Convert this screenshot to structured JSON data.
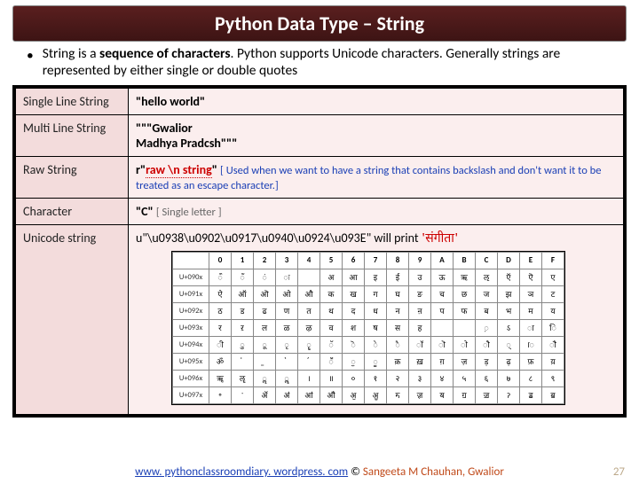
{
  "title": "Python Data Type – String",
  "bullet": {
    "lead": "String is a ",
    "bold": "sequence of characters",
    "rest": ". Python supports Unicode characters. Generally strings are represented by either single or double quotes"
  },
  "rows": {
    "r0": {
      "label": "Single Line String",
      "val": "\"hello world\""
    },
    "r1": {
      "label": "Multi Line String",
      "l1": "\"\"\"Gwalior",
      "l2": "Madhya Pradcsh\"\"\""
    },
    "r2": {
      "label": "Raw String",
      "pre": "r\"",
      "mid": "raw \\n string",
      "post": "\"",
      "note": "[ Used when we want to have a string that contains backslash and don't want it to be treated as an escape character.]"
    },
    "r3": {
      "label": "Character",
      "val": "\"C\"",
      "note": "[ Single letter ]"
    },
    "r4": {
      "label": "Unicode string",
      "code": "u\"\\u0938\\u0902\\u0917\\u0940\\u0924\\u093E\"",
      "tail": " will print ",
      "hindi": "'संगीता'"
    }
  },
  "chart_data": {
    "type": "table",
    "title": "Devanagari Unicode block U+0900–U+097F (partial)",
    "columns": [
      "0",
      "1",
      "2",
      "3",
      "4",
      "5",
      "6",
      "7",
      "8",
      "9",
      "A",
      "B",
      "C",
      "D",
      "E",
      "F"
    ],
    "row_headers": [
      "U+090x",
      "U+091x",
      "U+092x",
      "U+093x",
      "U+094x",
      "U+095x",
      "U+096x",
      "U+097x"
    ],
    "grid": [
      [
        "ऀ",
        "ँ",
        "ं",
        "ः",
        "",
        "अ",
        "आ",
        "इ",
        "ई",
        "उ",
        "ऊ",
        "ऋ",
        "ऌ",
        "ऍ",
        "ऎ",
        "ए"
      ],
      [
        "ऐ",
        "ऑ",
        "ऒ",
        "ओ",
        "औ",
        "क",
        "ख",
        "ग",
        "घ",
        "ङ",
        "च",
        "छ",
        "ज",
        "झ",
        "ञ",
        "ट"
      ],
      [
        "ठ",
        "ड",
        "ढ",
        "ण",
        "त",
        "थ",
        "द",
        "ध",
        "न",
        "ऩ",
        "प",
        "फ",
        "ब",
        "भ",
        "म",
        "य"
      ],
      [
        "र",
        "ऱ",
        "ल",
        "ळ",
        "ऴ",
        "व",
        "श",
        "ष",
        "स",
        "ह",
        "",
        "",
        "़",
        "ऽ",
        "ा",
        "ि"
      ],
      [
        "ी",
        "ु",
        "ू",
        "ृ",
        "ॄ",
        "ॅ",
        "ॆ",
        "े",
        "ै",
        "ॉ",
        "ॊ",
        "ो",
        "ौ",
        "्",
        "ॎ",
        "ॏ"
      ],
      [
        "ॐ",
        "॑",
        "॒",
        "॓",
        "॔",
        "ॕ",
        "ॖ",
        "ॗ",
        "क़",
        "ख़",
        "ग़",
        "ज़",
        "ड़",
        "ढ़",
        "फ़",
        "य़"
      ],
      [
        "ॠ",
        "ॡ",
        "ॢ",
        "ॣ",
        "।",
        "॥",
        "०",
        "१",
        "२",
        "३",
        "४",
        "५",
        "६",
        "७",
        "८",
        "९"
      ],
      [
        "॰",
        "ॱ",
        "ॲ",
        "ॳ",
        "ॴ",
        "ॵ",
        "ॶ",
        "ॷ",
        "ॸ",
        "ॹ",
        "ॺ",
        "ॻ",
        "ॼ",
        "ॽ",
        "ॾ",
        "ॿ"
      ]
    ]
  },
  "footer": {
    "link": "www. pythonclassroomdiary. wordpress. com",
    "sep": " © ",
    "author": "Sangeeta M Chauhan, Gwalior"
  },
  "pagenum": "27"
}
